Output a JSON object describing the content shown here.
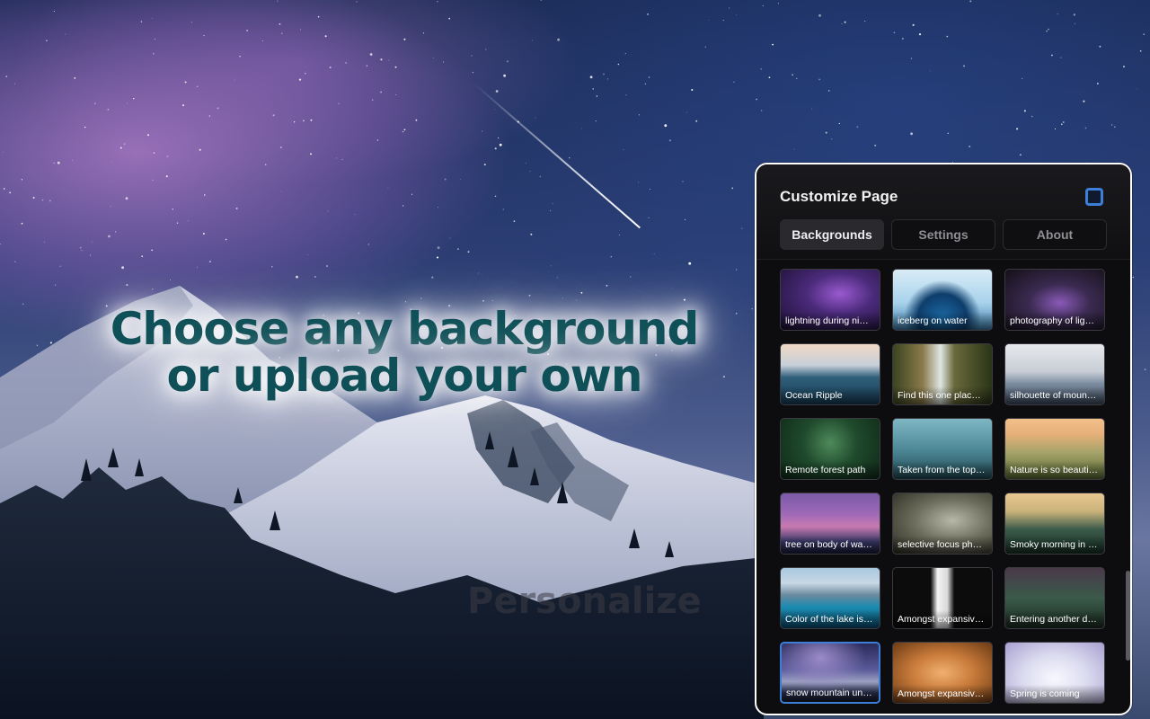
{
  "hero": {
    "line1": "Choose any background",
    "line2": "or upload your own"
  },
  "watermark": "Personalize",
  "panel": {
    "title": "Customize Page",
    "window_icon": "square-outline-icon",
    "tabs": [
      {
        "label": "Backgrounds",
        "active": true
      },
      {
        "label": "Settings",
        "active": false
      },
      {
        "label": "About",
        "active": false
      }
    ],
    "backgrounds": [
      {
        "label": "lightning during ni…",
        "selected": false
      },
      {
        "label": "iceberg on water",
        "selected": false
      },
      {
        "label": "photography of lig…",
        "selected": false
      },
      {
        "label": "Ocean Ripple",
        "selected": false
      },
      {
        "label": "Find this one plac…",
        "selected": false
      },
      {
        "label": "silhouette of moun…",
        "selected": false
      },
      {
        "label": "Remote forest path",
        "selected": false
      },
      {
        "label": "Taken from the top…",
        "selected": false
      },
      {
        "label": "Nature is so beauti…",
        "selected": false
      },
      {
        "label": "tree on body of wa…",
        "selected": false
      },
      {
        "label": "selective focus ph…",
        "selected": false
      },
      {
        "label": "Smoky morning in …",
        "selected": false
      },
      {
        "label": "Color of the lake is…",
        "selected": false
      },
      {
        "label": "Amongst expansiv…",
        "selected": false
      },
      {
        "label": "Entering another d…",
        "selected": false
      },
      {
        "label": "snow mountain un…",
        "selected": true
      },
      {
        "label": "Amongst expansiv…",
        "selected": false
      },
      {
        "label": "Spring is coming",
        "selected": false
      }
    ]
  },
  "colors": {
    "accent": "#3d7fd8",
    "hero_text": "#0f4f57",
    "panel_bg": "#0d0d0f"
  }
}
